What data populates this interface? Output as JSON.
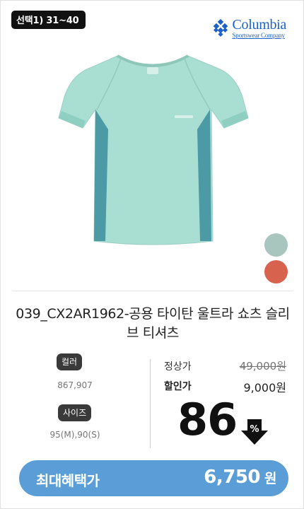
{
  "badge": {
    "label": "선택1) 31~40"
  },
  "brand": {
    "name": "Columbia",
    "subtitle": "Sportswear Company"
  },
  "product": {
    "image_icon": "t-shirt-image",
    "title": "039_CX2AR1962-공용 타이탄 울트라 쇼츠 슬리브 티셔츠",
    "swatches": [
      "#a8c5be",
      "#d7634e"
    ]
  },
  "options": {
    "color_label": "컬러",
    "color_value": "867,907",
    "size_label": "사이즈",
    "size_value": "95(M),90(S)"
  },
  "price": {
    "regular_label": "정상가",
    "regular_value": "49,000원",
    "sale_label": "할인가",
    "sale_value": "9,000원",
    "discount": "86",
    "discount_icon": "percent-down-arrow-icon"
  },
  "benefit": {
    "label": "최대혜택가",
    "value": "6,750",
    "unit": "원",
    "color": "#5b9ed7"
  }
}
